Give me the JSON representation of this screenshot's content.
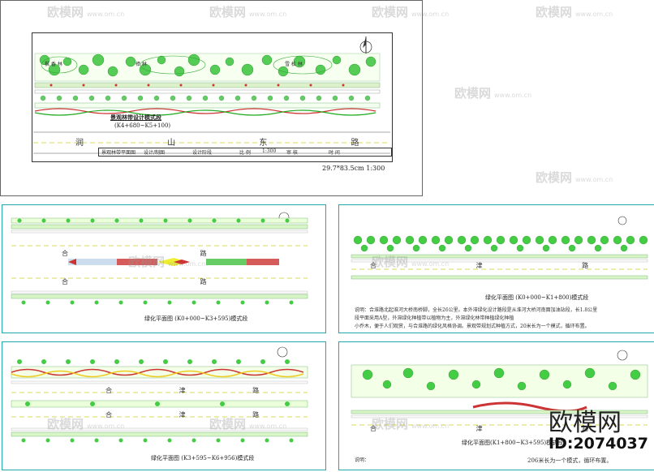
{
  "watermark": {
    "brand": "欧模网",
    "url": "www.om.cn"
  },
  "top_sheet": {
    "title": "景观林带设计模式段",
    "subtitle": "(K4+680~K5+100)",
    "road_name": "润 山 东 路",
    "paper_note": "29.7*83.5cm  1:300",
    "plant_labels": [
      "枫 香 林",
      "樟 林",
      "雪 松 林"
    ],
    "tb": {
      "c1": "景观林带平面图",
      "c2": "设计/制图",
      "c3": "设计阶段",
      "c4": "比 例",
      "c5": "1:300",
      "c6": "审 核",
      "c7": "时 间"
    }
  },
  "sheet_a": {
    "road_upper": "合 路",
    "road_lower": "合 路",
    "caption": "绿化平面图 (K0+000~K3+595)模式段"
  },
  "sheet_b": {
    "road": "合 津 路",
    "caption": "绿化平面图 (K0+000~K1+800)模式段",
    "note1": "说明：合淮路北起淮河大桥南桥脚，全长26公里。本外滞绿化设计路段是从淮河大桥河南面加油站段，长1.8公里",
    "note2": "段平面采用A型，外滞绿化种植带以植物为主，外滞绿化林带种植绿化种植",
    "note3": "小乔木，便于人们观赏，与合淮路的绿化风格协调。景观带规划式种植方式，20米长为一个模式，循环布置。"
  },
  "sheet_c": {
    "road_upper": "合 津 路",
    "road_lower": "合 津 路",
    "caption": "绿化平面图 (K3+595~K6+956)模式段"
  },
  "sheet_d": {
    "road": "合 津 路",
    "caption": "绿化平面图(K1+800~K3+595)模式段",
    "note": "206米长为一个模式，循环布置。",
    "legend_label": "说明："
  },
  "id_label": "ID:2074037",
  "colors": {
    "green": "#22aa22",
    "light_green": "#88dd55",
    "red": "#cc2222",
    "yellow": "#eecc22",
    "teal": "#22a0a0"
  }
}
